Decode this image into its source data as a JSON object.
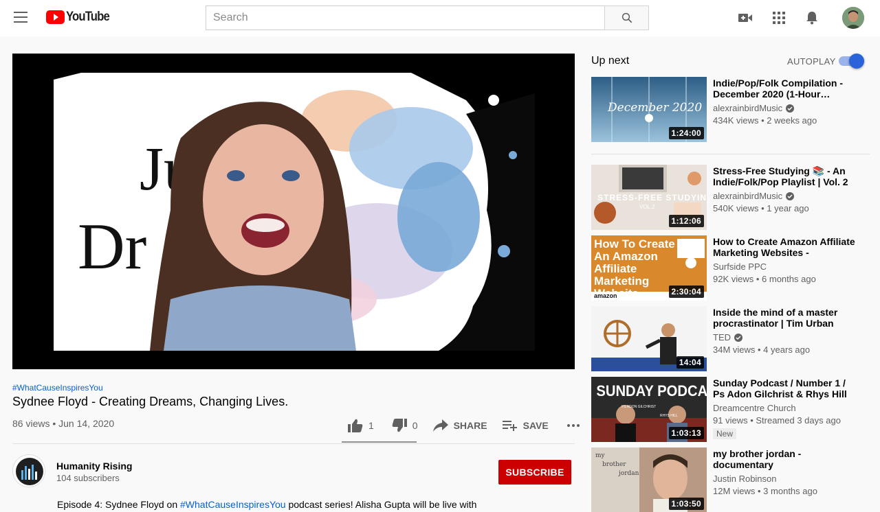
{
  "header": {
    "logo_text": "YouTube",
    "search_placeholder": "Search"
  },
  "video": {
    "overlay_name": "Sydnee Floyd",
    "backdrop_text_line1": "Ju      ed",
    "backdrop_text_line2": "Dr",
    "hashtag": "#WhatCauseInspiresYou",
    "title": "Sydnee Floyd - Creating Dreams, Changing Lives.",
    "meta": "86 views • Jun 14, 2020",
    "likes": "1",
    "dislikes": "0",
    "share_label": "SHARE",
    "save_label": "SAVE"
  },
  "channel": {
    "name": "Humanity Rising",
    "subscribers": "104 subscribers",
    "subscribe_label": "SUBSCRIBE"
  },
  "description": {
    "prefix": "Episode 4: Sydnee Floyd on ",
    "link": "#WhatCauseInspiresYou",
    "suffix": " podcast series! Alisha Gupta will be live with"
  },
  "sidebar": {
    "up_next": "Up next",
    "autoplay": "AUTOPLAY",
    "items": [
      {
        "title": "Indie/Pop/Folk Compilation - December 2020 (1-Hour…",
        "channel": "alexrainbirdMusic",
        "verified": true,
        "stats": "434K views • 2 weeks ago",
        "duration": "1:24:00",
        "thumb_text": "December 2020"
      },
      {
        "title": "Stress-Free Studying 📚 - An Indie/Folk/Pop Playlist | Vol. 2",
        "channel": "alexrainbirdMusic",
        "verified": true,
        "stats": "540K views • 1 year ago",
        "duration": "1:12:06",
        "thumb_text": "STRESS-FREE STUDYING",
        "thumb_sub": "VOL.2"
      },
      {
        "title": "How to Create Amazon Affiliate Marketing Websites - Amazon…",
        "channel": "Surfside PPC",
        "verified": false,
        "stats": "92K views • 6 months ago",
        "duration": "2:30:04",
        "thumb_text": "How To Create An Amazon Affiliate Marketing Website",
        "thumb_sub": "amazon"
      },
      {
        "title": "Inside the mind of a master procrastinator | Tim Urban",
        "channel": "TED",
        "verified": true,
        "stats": "34M views • 4 years ago",
        "duration": "14:04"
      },
      {
        "title": "Sunday Podcast / Number 1 / Ps Adon Gilchrist & Rhys Hill",
        "channel": "Dreamcentre Church",
        "verified": false,
        "stats": "91 views • Streamed 3 days ago",
        "badge": "New",
        "duration": "1:03:13",
        "thumb_text": "SUNDAY PODCAST",
        "thumb_sub1": "PS ADON GILCHRIST",
        "thumb_sub2": "RHYS HILL"
      },
      {
        "title": "my brother jordan - documentary",
        "channel": "Justin Robinson",
        "verified": false,
        "stats": "12M views • 3 months ago",
        "duration": "1:03:50",
        "thumb_text1": "my",
        "thumb_text2": "brother",
        "thumb_text3": "jordan"
      }
    ]
  }
}
